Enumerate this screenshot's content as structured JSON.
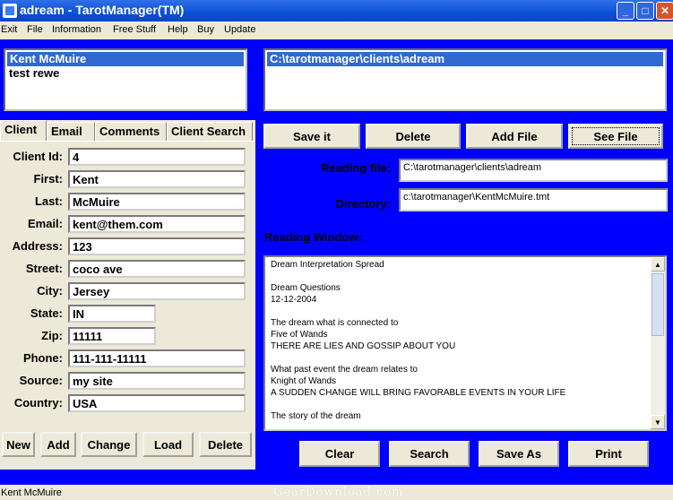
{
  "window": {
    "title": "adream - TarotManager(TM)",
    "icons": {
      "minimize": "minimize-icon",
      "maximize": "maximize-icon",
      "close": "close-icon"
    }
  },
  "menu": [
    "Exit",
    "File",
    "Information",
    "Free Stuff",
    "Help",
    "Buy",
    "Update"
  ],
  "client_list": {
    "items": [
      "Kent McMuire",
      "test rewe"
    ],
    "selected_index": 0
  },
  "file_list": {
    "items": [
      "C:\\tarotmanager\\clients\\adream"
    ],
    "selected_index": 0
  },
  "tabs": [
    "Client",
    "Email",
    "Comments",
    "Client Search"
  ],
  "active_tab": "Client",
  "client_form": {
    "labels": {
      "client_id": "Client Id:",
      "first": "First:",
      "last": "Last:",
      "email": "Email:",
      "address": "Address:",
      "street": "Street:",
      "city": "City:",
      "state": "State:",
      "zip": "Zip:",
      "phone": "Phone:",
      "source": "Source:",
      "country": "Country:"
    },
    "values": {
      "client_id": "4",
      "first": "Kent",
      "last": "McMuire",
      "email": "kent@them.com",
      "address": "123",
      "street": "coco ave",
      "city": "Jersey",
      "state": "IN",
      "zip": "11111",
      "phone": "111-111-11111",
      "source": "my site",
      "country": "USA"
    }
  },
  "client_buttons": {
    "new": "New",
    "add": "Add",
    "change": "Change",
    "load": "Load",
    "delete": "Delete"
  },
  "file_buttons": {
    "save_it": "Save it",
    "delete": "Delete",
    "add_file": "Add File",
    "see_file": "See File"
  },
  "reading": {
    "file_label": "Reading file:",
    "file_value": "C:\\tarotmanager\\clients\\adream",
    "directory_label": "Directory:",
    "directory_value": "c:\\tarotmanager\\KentMcMuire.tmt",
    "window_label": "Reading Window:",
    "content": "Dream Interpretation Spread\n\nDream Questions\n12-12-2004\n\nThe dream what is connected to\nFive of Wands\nTHERE ARE LIES AND GOSSIP ABOUT YOU\n\nWhat past event the dream relates to\nKnight of Wands\nA SUDDEN CHANGE WILL BRING FAVORABLE EVENTS IN YOUR LIFE\n\nThe story of the dream"
  },
  "reading_buttons": {
    "clear": "Clear",
    "search": "Search",
    "save_as": "Save As",
    "print": "Print"
  },
  "status": {
    "text": "Kent McMuire",
    "watermark": "GearDownload.com"
  },
  "colors": {
    "background": "#0000FF",
    "selection": "#3168D2",
    "panel": "#ECE9D8"
  }
}
